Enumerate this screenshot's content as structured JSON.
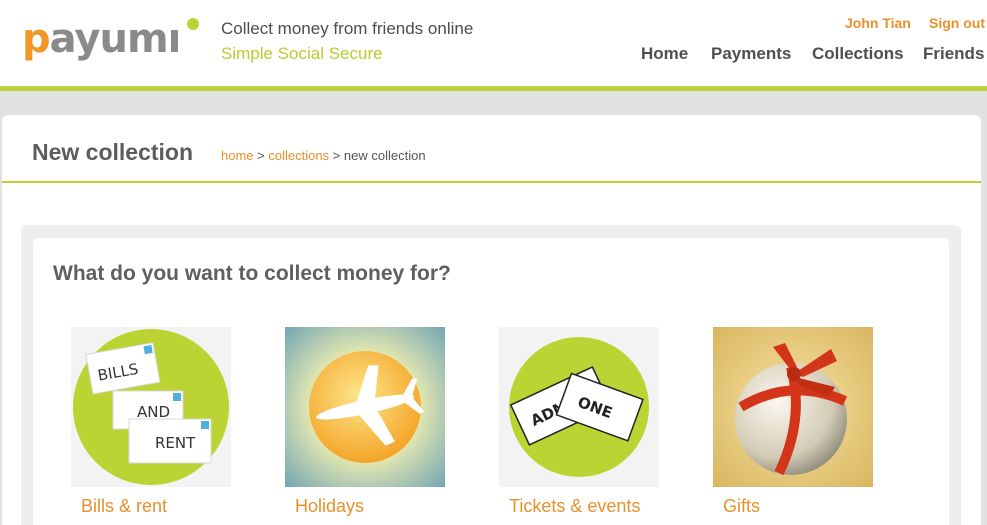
{
  "brand": {
    "logo_text": "payumi",
    "tagline": "Collect money from friends online",
    "slogan": "Simple Social Secure",
    "colors": {
      "orange": "#f1962b",
      "green": "#bfd137",
      "dark": "#555555"
    }
  },
  "user": {
    "name": "John Tian",
    "sign_out": "Sign out"
  },
  "nav": [
    {
      "label": "Home"
    },
    {
      "label": "Payments"
    },
    {
      "label": "Collections"
    },
    {
      "label": "Friends"
    }
  ],
  "page": {
    "title": "New collection",
    "breadcrumb": {
      "home": "home",
      "sep1": " > ",
      "collections": "collections",
      "sep2": " > ",
      "current": "new collection"
    },
    "question": "What do you want to collect money for?"
  },
  "categories": [
    {
      "label": "Bills & rent",
      "icon": "bills-icon",
      "art_text": [
        "BILLS",
        "AND",
        "RENT"
      ]
    },
    {
      "label": "Holidays",
      "icon": "airplane-icon"
    },
    {
      "label": "Tickets & events",
      "icon": "ticket-icon",
      "art_text": [
        "ADMIT",
        "ONE"
      ]
    },
    {
      "label": "Gifts",
      "icon": "gift-icon"
    }
  ]
}
